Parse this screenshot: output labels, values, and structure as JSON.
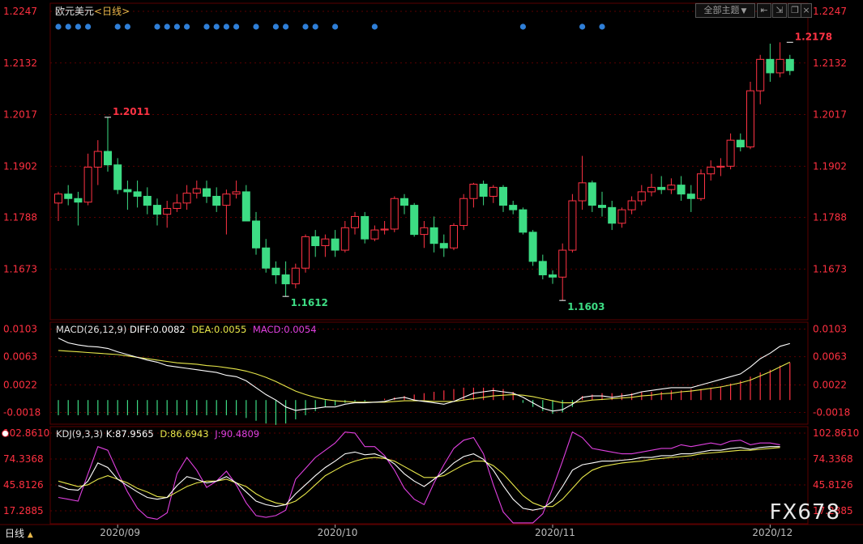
{
  "header": {
    "symbol": "欧元美元",
    "period": "<日线>",
    "theme_button": "全部主题",
    "theme_arrow": "▼"
  },
  "indicators": {
    "macd": {
      "name": "MACD(26,12,9)",
      "diff": "DIFF:0.0082",
      "dea": "DEA:0.0055",
      "macd": "MACD:0.0054"
    },
    "kdj": {
      "name": "KDJ(9,3,3)",
      "k": "K:87.9565",
      "d": "D:86.6943",
      "j": "J:90.4809"
    }
  },
  "footer": {
    "period_label": "日线",
    "period_arrow": "▲"
  },
  "watermark": "FX678",
  "colors": {
    "up": "#ff3344",
    "down": "#3ddc84",
    "diff": "#ffffff",
    "dea": "#e8e84a",
    "j": "#e040e0",
    "dot": "#2f7fd8",
    "grid": "#5a0000"
  },
  "chart_data": [
    {
      "type": "candlestick",
      "title": "欧元美元",
      "y_ticks": [
        "1.2247",
        "1.2132",
        "1.2017",
        "1.1902",
        "1.1788",
        "1.1673"
      ],
      "ylim": [
        1.156,
        1.2265
      ],
      "x_ticks": [
        {
          "label": "2020/09",
          "index": 6
        },
        {
          "label": "2020/10",
          "index": 28
        },
        {
          "label": "2020/11",
          "index": 50
        },
        {
          "label": "2020/12",
          "index": 72
        }
      ],
      "annotations": [
        {
          "text": "1.2011",
          "index": 5,
          "value": 1.2011,
          "kind": "high"
        },
        {
          "text": "1.1612",
          "index": 23,
          "value": 1.1612,
          "kind": "low"
        },
        {
          "text": "1.1603",
          "index": 51,
          "value": 1.1603,
          "kind": "low"
        },
        {
          "text": "1.2178",
          "index": 74,
          "value": 1.2178,
          "kind": "high"
        }
      ],
      "signal_dot_indices": [
        0,
        1,
        2,
        3,
        6,
        7,
        10,
        11,
        12,
        13,
        15,
        16,
        17,
        18,
        20,
        22,
        23,
        25,
        26,
        28,
        32,
        47,
        53,
        55
      ],
      "ohlc": [
        [
          1.182,
          1.1845,
          1.178,
          1.184
        ],
        [
          1.184,
          1.186,
          1.1815,
          1.183
        ],
        [
          1.183,
          1.1845,
          1.177,
          1.1822
        ],
        [
          1.1822,
          1.193,
          1.1815,
          1.19
        ],
        [
          1.19,
          1.196,
          1.186,
          1.1935
        ],
        [
          1.1935,
          1.2011,
          1.189,
          1.1905
        ],
        [
          1.1905,
          1.192,
          1.184,
          1.185
        ],
        [
          1.185,
          1.187,
          1.1805,
          1.1845
        ],
        [
          1.1845,
          1.187,
          1.181,
          1.1835
        ],
        [
          1.1835,
          1.1855,
          1.1795,
          1.1815
        ],
        [
          1.1815,
          1.183,
          1.177,
          1.1795
        ],
        [
          1.1795,
          1.1825,
          1.1765,
          1.1808
        ],
        [
          1.1808,
          1.184,
          1.18,
          1.182
        ],
        [
          1.182,
          1.186,
          1.1805,
          1.1842
        ],
        [
          1.1842,
          1.187,
          1.183,
          1.1852
        ],
        [
          1.1852,
          1.187,
          1.182,
          1.1835
        ],
        [
          1.1835,
          1.1855,
          1.18,
          1.1815
        ],
        [
          1.1815,
          1.185,
          1.175,
          1.184
        ],
        [
          1.184,
          1.187,
          1.183,
          1.1845
        ],
        [
          1.1845,
          1.186,
          1.178,
          1.178
        ],
        [
          1.178,
          1.18,
          1.1705,
          1.172
        ],
        [
          1.172,
          1.174,
          1.1665,
          1.1675
        ],
        [
          1.1675,
          1.169,
          1.164,
          1.166
        ],
        [
          1.166,
          1.169,
          1.1612,
          1.164
        ],
        [
          1.164,
          1.1685,
          1.163,
          1.1675
        ],
        [
          1.1675,
          1.175,
          1.1665,
          1.1745
        ],
        [
          1.1745,
          1.176,
          1.17,
          1.1725
        ],
        [
          1.1725,
          1.175,
          1.17,
          1.174
        ],
        [
          1.174,
          1.176,
          1.17,
          1.1715
        ],
        [
          1.1715,
          1.178,
          1.171,
          1.1765
        ],
        [
          1.1765,
          1.18,
          1.175,
          1.179
        ],
        [
          1.179,
          1.18,
          1.173,
          1.174
        ],
        [
          1.174,
          1.177,
          1.1735,
          1.176
        ],
        [
          1.176,
          1.178,
          1.175,
          1.1762
        ],
        [
          1.1762,
          1.1835,
          1.1755,
          1.183
        ],
        [
          1.183,
          1.184,
          1.1795,
          1.1815
        ],
        [
          1.1815,
          1.182,
          1.1745,
          1.175
        ],
        [
          1.175,
          1.178,
          1.172,
          1.1765
        ],
        [
          1.1765,
          1.179,
          1.171,
          1.173
        ],
        [
          1.173,
          1.175,
          1.17,
          1.172
        ],
        [
          1.172,
          1.1775,
          1.1715,
          1.177
        ],
        [
          1.177,
          1.184,
          1.176,
          1.183
        ],
        [
          1.183,
          1.1865,
          1.181,
          1.1862
        ],
        [
          1.1862,
          1.187,
          1.1815,
          1.1835
        ],
        [
          1.1835,
          1.186,
          1.182,
          1.1855
        ],
        [
          1.1855,
          1.186,
          1.18,
          1.1815
        ],
        [
          1.1815,
          1.1825,
          1.1795,
          1.1805
        ],
        [
          1.1805,
          1.181,
          1.175,
          1.1755
        ],
        [
          1.1755,
          1.176,
          1.168,
          1.169
        ],
        [
          1.169,
          1.1705,
          1.165,
          1.166
        ],
        [
          1.166,
          1.167,
          1.164,
          1.1655
        ],
        [
          1.1655,
          1.173,
          1.1603,
          1.1715
        ],
        [
          1.1715,
          1.184,
          1.171,
          1.1825
        ],
        [
          1.1825,
          1.1925,
          1.1805,
          1.1865
        ],
        [
          1.1865,
          1.187,
          1.18,
          1.1815
        ],
        [
          1.1815,
          1.1845,
          1.179,
          1.181
        ],
        [
          1.181,
          1.1825,
          1.176,
          1.1775
        ],
        [
          1.1775,
          1.181,
          1.1765,
          1.1805
        ],
        [
          1.1805,
          1.1835,
          1.1795,
          1.1825
        ],
        [
          1.1825,
          1.186,
          1.1815,
          1.1845
        ],
        [
          1.1845,
          1.1885,
          1.1835,
          1.1855
        ],
        [
          1.1855,
          1.188,
          1.184,
          1.185
        ],
        [
          1.185,
          1.1875,
          1.184,
          1.186
        ],
        [
          1.186,
          1.188,
          1.1825,
          1.184
        ],
        [
          1.184,
          1.186,
          1.18,
          1.183
        ],
        [
          1.183,
          1.1895,
          1.1825,
          1.1885
        ],
        [
          1.1885,
          1.1915,
          1.187,
          1.19
        ],
        [
          1.19,
          1.192,
          1.188,
          1.1902
        ],
        [
          1.1902,
          1.1975,
          1.1895,
          1.196
        ],
        [
          1.196,
          1.1975,
          1.1935,
          1.1945
        ],
        [
          1.1945,
          1.209,
          1.194,
          1.207
        ],
        [
          1.207,
          1.215,
          1.204,
          1.214
        ],
        [
          1.214,
          1.2175,
          1.209,
          1.211
        ],
        [
          1.211,
          1.2178,
          1.21,
          1.214
        ],
        [
          1.214,
          1.215,
          1.2105,
          1.2115
        ]
      ]
    },
    {
      "type": "line+bar",
      "title": "MACD(26,12,9)",
      "y_ticks": [
        "0.0103",
        "0.0063",
        "0.0022",
        "-0.0018"
      ],
      "ylim": [
        -0.0035,
        0.0113
      ],
      "series": [
        {
          "name": "DIFF",
          "values": [
            0.009,
            0.0083,
            0.008,
            0.0078,
            0.0077,
            0.0075,
            0.007,
            0.0066,
            0.0062,
            0.0058,
            0.0055,
            0.005,
            0.0048,
            0.0046,
            0.0044,
            0.0042,
            0.004,
            0.0036,
            0.0034,
            0.0028,
            0.0018,
            0.0008,
            0.0,
            -0.001,
            -0.0015,
            -0.0013,
            -0.0012,
            -0.001,
            -0.001,
            -0.0006,
            -0.0004,
            -0.0004,
            -0.0003,
            -0.0002,
            0.0002,
            0.0004,
            0.0,
            -0.0002,
            -0.0004,
            -0.0006,
            -0.0002,
            0.0004,
            0.001,
            0.0012,
            0.0014,
            0.0012,
            0.001,
            0.0004,
            -0.0004,
            -0.0012,
            -0.0016,
            -0.0014,
            -0.0006,
            0.0004,
            0.0006,
            0.0006,
            0.0004,
            0.0006,
            0.0008,
            0.0012,
            0.0014,
            0.0016,
            0.0018,
            0.0018,
            0.0018,
            0.0022,
            0.0026,
            0.003,
            0.0034,
            0.0038,
            0.0048,
            0.006,
            0.0068,
            0.0078,
            0.0082
          ]
        },
        {
          "name": "DEA",
          "values": [
            0.0072,
            0.0071,
            0.007,
            0.0069,
            0.0068,
            0.0067,
            0.0066,
            0.0064,
            0.0062,
            0.006,
            0.0058,
            0.0056,
            0.0054,
            0.0053,
            0.0052,
            0.005,
            0.0049,
            0.0047,
            0.0045,
            0.0042,
            0.0038,
            0.0033,
            0.0027,
            0.002,
            0.0013,
            0.0008,
            0.0004,
            0.0001,
            -0.0001,
            -0.0002,
            -0.0003,
            -0.0003,
            -0.0003,
            -0.0003,
            -0.0002,
            -0.0001,
            -0.0001,
            -0.0001,
            -0.0002,
            -0.0002,
            -0.0002,
            0.0,
            0.0002,
            0.0004,
            0.0006,
            0.0007,
            0.0008,
            0.0007,
            0.0005,
            0.0002,
            -0.0001,
            -0.0004,
            -0.0004,
            -0.0002,
            0.0,
            0.0001,
            0.0002,
            0.0003,
            0.0004,
            0.0006,
            0.0007,
            0.0009,
            0.001,
            0.0012,
            0.0013,
            0.0015,
            0.0017,
            0.0019,
            0.0022,
            0.0025,
            0.0029,
            0.0035,
            0.0041,
            0.0048,
            0.0055
          ]
        },
        {
          "name": "MACD",
          "values": [
            -0.0022,
            -0.0022,
            -0.0022,
            -0.0022,
            -0.0022,
            -0.0022,
            -0.0022,
            -0.0022,
            -0.0022,
            -0.0022,
            -0.0022,
            -0.0022,
            -0.0022,
            -0.0022,
            -0.0022,
            -0.0022,
            -0.0022,
            -0.0022,
            -0.0022,
            -0.0026,
            -0.003,
            -0.0034,
            -0.0036,
            -0.0034,
            -0.0028,
            -0.0022,
            -0.0016,
            -0.001,
            -0.0008,
            -0.0004,
            -0.0002,
            -0.0002,
            0.0,
            0.0002,
            0.0004,
            0.0006,
            0.0008,
            0.001,
            0.0012,
            0.0014,
            0.0016,
            0.0018,
            0.0018,
            0.0018,
            0.0018,
            0.0016,
            0.0012,
            -0.0004,
            -0.001,
            -0.0016,
            -0.002,
            -0.0018,
            -0.001,
            0.0006,
            0.0008,
            0.001,
            0.001,
            0.001,
            0.001,
            0.0012,
            0.0012,
            0.0012,
            0.0014,
            0.0014,
            0.0016,
            0.0016,
            0.0018,
            0.002,
            0.0024,
            0.0028,
            0.0034,
            0.004,
            0.0044,
            0.005,
            0.0054
          ]
        }
      ]
    },
    {
      "type": "line",
      "title": "KDJ(9,3,3)",
      "y_ticks": [
        "102.8610",
        "74.3368",
        "45.8126",
        "17.2885"
      ],
      "ylim": [
        3,
        110
      ],
      "series": [
        {
          "name": "K",
          "values": [
            45,
            41,
            40,
            50,
            70,
            65,
            52,
            45,
            38,
            32,
            30,
            32,
            45,
            55,
            52,
            48,
            50,
            55,
            48,
            38,
            28,
            24,
            22,
            24,
            36,
            46,
            56,
            65,
            72,
            80,
            82,
            79,
            80,
            76,
            69,
            58,
            50,
            44,
            52,
            60,
            70,
            77,
            80,
            74,
            62,
            45,
            30,
            20,
            18,
            20,
            28,
            44,
            62,
            68,
            70,
            72,
            72,
            73,
            74,
            76,
            76,
            78,
            78,
            80,
            80,
            82,
            84,
            84,
            86,
            87,
            85,
            87,
            88,
            88
          ]
        },
        {
          "name": "D",
          "values": [
            50,
            47,
            44,
            46,
            52,
            56,
            52,
            48,
            42,
            38,
            33,
            32,
            38,
            44,
            48,
            50,
            50,
            52,
            48,
            44,
            36,
            30,
            26,
            24,
            28,
            36,
            46,
            56,
            62,
            68,
            72,
            75,
            76,
            75,
            72,
            66,
            60,
            54,
            54,
            56,
            62,
            68,
            72,
            72,
            67,
            58,
            46,
            34,
            26,
            22,
            22,
            30,
            42,
            54,
            62,
            66,
            68,
            70,
            71,
            72,
            74,
            75,
            76,
            77,
            78,
            80,
            81,
            82,
            83,
            84,
            84,
            85,
            86,
            87
          ]
        },
        {
          "name": "J",
          "values": [
            32,
            30,
            28,
            58,
            88,
            84,
            60,
            38,
            20,
            10,
            8,
            15,
            58,
            76,
            62,
            43,
            50,
            61,
            46,
            26,
            12,
            10,
            12,
            18,
            52,
            64,
            76,
            84,
            92,
            104,
            103,
            88,
            88,
            78,
            62,
            42,
            30,
            24,
            48,
            68,
            86,
            95,
            98,
            80,
            46,
            16,
            4,
            4,
            4,
            14,
            42,
            72,
            104,
            98,
            86,
            84,
            82,
            80,
            80,
            82,
            84,
            86,
            86,
            90,
            88,
            90,
            92,
            90,
            94,
            95,
            90,
            92,
            92,
            90
          ]
        }
      ]
    }
  ]
}
